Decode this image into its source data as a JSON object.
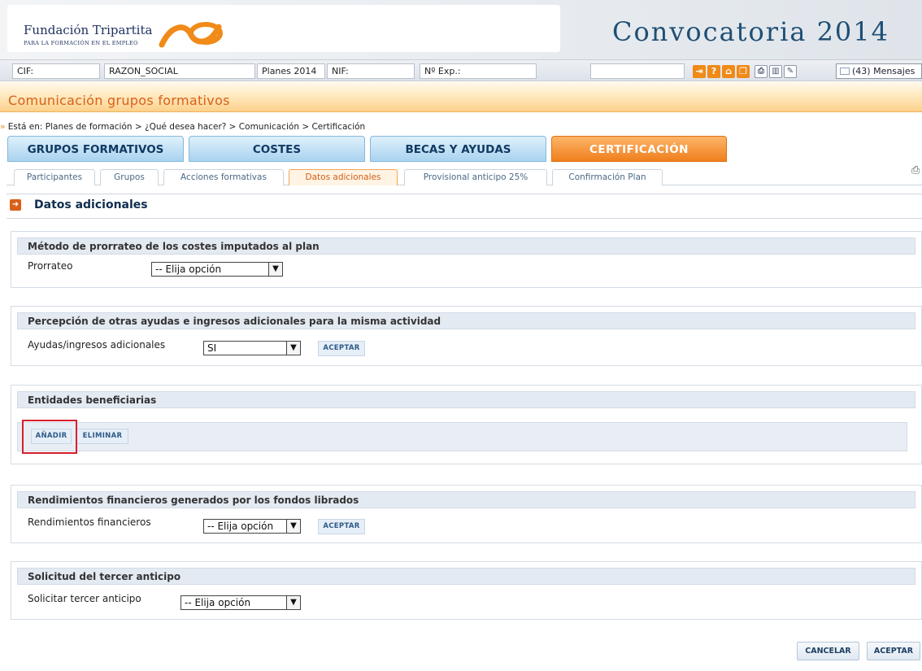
{
  "header": {
    "logo_title": "Fundación Tripartita",
    "logo_subtitle": "PARA LA FORMACIÓN EN EL EMPLEO",
    "convocatoria": "Convocatoria 2014"
  },
  "info_bar": {
    "cif": "CIF:",
    "razon_social": "RAZON_SOCIAL",
    "planes": "Planes 2014",
    "nif": "NIF:",
    "n_exp": "Nº Exp.:",
    "messages": "(43) Mensajes",
    "icons": [
      "exit-icon",
      "help-icon",
      "home-icon",
      "copy-icon",
      "pdf-icon",
      "chart-icon",
      "edit-icon"
    ]
  },
  "page_title": "Comunicación grupos formativos",
  "breadcrumb": {
    "prefix": "Está en:",
    "path": "Planes de formación > ¿Qué desea hacer? > Comunicación > Certificación"
  },
  "main_tabs": [
    {
      "label": "GRUPOS FORMATIVOS"
    },
    {
      "label": "COSTES"
    },
    {
      "label": "BECAS Y AYUDAS"
    },
    {
      "label": "CERTIFICACIÓN"
    }
  ],
  "sub_tabs": [
    {
      "label": "Participantes"
    },
    {
      "label": "Grupos"
    },
    {
      "label": "Acciones formativas"
    },
    {
      "label": "Datos adicionales"
    },
    {
      "label": "Provisional anticipo 25%"
    },
    {
      "label": "Confirmación Plan"
    }
  ],
  "section_title": "Datos adicionales",
  "panels": {
    "prorrateo": {
      "title": "Método de prorrateo de los costes imputados al plan",
      "label": "Prorrateo",
      "value": "-- Elija opción"
    },
    "ayudas": {
      "title": "Percepción de otras ayudas e ingresos adicionales para la misma actividad",
      "label": "Ayudas/ingresos adicionales",
      "value": "SI",
      "button": "ACEPTAR"
    },
    "entidades": {
      "title": "Entidades beneficiarias",
      "add_button": "AÑADIR",
      "delete_button": "ELIMINAR"
    },
    "rendimientos": {
      "title": "Rendimientos financieros generados por los fondos librados",
      "label": "Rendimientos financieros",
      "value": "-- Elija opción",
      "button": "ACEPTAR"
    },
    "anticipo": {
      "title": "Solicitud del tercer anticipo",
      "label": "Solicitar tercer anticipo",
      "value": "-- Elija opción"
    }
  },
  "footer": {
    "cancel": "CANCELAR",
    "accept": "ACEPTAR"
  },
  "colors": {
    "accent_orange": "#f07f1c",
    "tab_blue": "#a9d3ef",
    "highlight_red": "#d61f2c",
    "title_orange": "#d9601a"
  }
}
